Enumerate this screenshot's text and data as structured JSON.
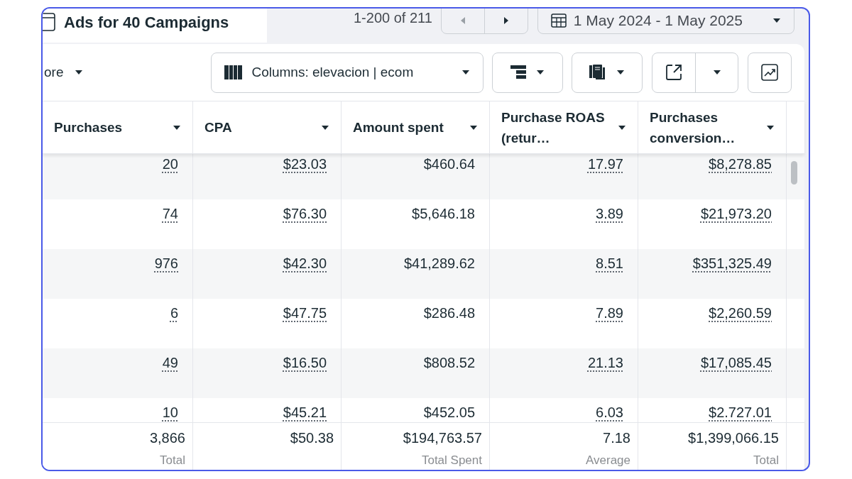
{
  "tab": {
    "title": "Ads for 40 Campaigns"
  },
  "pagination": {
    "range": "1-200 of 211",
    "prev_disabled": true,
    "next_disabled": false
  },
  "date_range": {
    "label": "1 May 2024 - 1 May 2025"
  },
  "toolbar": {
    "more_label": "ore",
    "columns_label": "Columns: elevacion | ecom"
  },
  "table": {
    "columns": [
      {
        "label": "Purchases",
        "dotted": true
      },
      {
        "label": "CPA",
        "dotted": true
      },
      {
        "label": "Amount spent",
        "dotted": false
      },
      {
        "label": "Purchase ROAS (retur…",
        "dotted": true
      },
      {
        "label": "Purchases conversion…",
        "dotted": true
      }
    ],
    "rows": [
      [
        "20",
        "$23.03",
        "$460.64",
        "17.97",
        "$8,278.85"
      ],
      [
        "74",
        "$76.30",
        "$5,646.18",
        "3.89",
        "$21,973.20"
      ],
      [
        "976",
        "$42.30",
        "$41,289.62",
        "8.51",
        "$351,325.49"
      ],
      [
        "6",
        "$47.75",
        "$286.48",
        "7.89",
        "$2,260.59"
      ],
      [
        "49",
        "$16.50",
        "$808.52",
        "21.13",
        "$17,085.45"
      ],
      [
        "10",
        "$45.21",
        "$452.05",
        "6.03",
        "$2.727.01"
      ]
    ],
    "totals": [
      {
        "value": "3,866",
        "label": "Total"
      },
      {
        "value": "$50.38"
      },
      {
        "value": "$194,763.57",
        "label": "Total Spent"
      },
      {
        "value": "7.18",
        "label": "Average"
      },
      {
        "value": "$1,399,066.15",
        "label": "Total"
      }
    ]
  }
}
